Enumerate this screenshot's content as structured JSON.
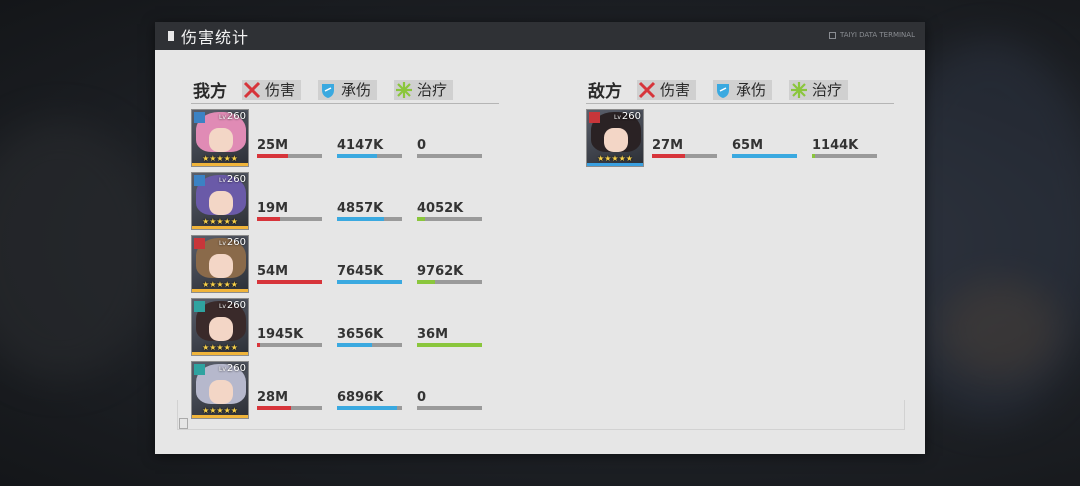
{
  "window": {
    "title": "伤害统计",
    "terminal_label": "TAIYI DATA TERMINAL"
  },
  "colors": {
    "damage": "#d7343a",
    "taken": "#3aa9e0",
    "heal": "#8ac63c",
    "track": "#9a9a9a",
    "rarity": "#f0b43a",
    "enemy_rarity": "#3aa0e0"
  },
  "headers": {
    "damage": "伤害",
    "taken": "承伤",
    "heal": "治疗",
    "damage_icon": "crossed-swords-icon",
    "taken_icon": "shield-icon",
    "heal_icon": "heal-burst-icon"
  },
  "ally": {
    "name": "我方",
    "members": [
      {
        "level": "260",
        "level_prefix": "Lv",
        "class_icon": "gear-class-icon",
        "class_color": "#3b82c4",
        "hair": "#e08bb5",
        "stars": "★★★★★",
        "damage": "25M",
        "damage_ratio": 0.48,
        "taken": "4147K",
        "taken_ratio": 0.62,
        "heal": "0",
        "heal_ratio": 0
      },
      {
        "level": "260",
        "level_prefix": "Lv",
        "class_icon": "gear-class-icon",
        "class_color": "#3b82c4",
        "hair": "#6a5aa8",
        "stars": "★★★★★",
        "damage": "19M",
        "damage_ratio": 0.36,
        "taken": "4857K",
        "taken_ratio": 0.72,
        "heal": "4052K",
        "heal_ratio": 0.12
      },
      {
        "level": "260",
        "level_prefix": "Lv",
        "class_icon": "tower-class-icon",
        "class_color": "#c8363a",
        "hair": "#8a6a4a",
        "stars": "★★★★★",
        "damage": "54M",
        "damage_ratio": 1.0,
        "taken": "7645K",
        "taken_ratio": 1.0,
        "heal": "9762K",
        "heal_ratio": 0.27
      },
      {
        "level": "260",
        "level_prefix": "Lv",
        "class_icon": "flower-class-icon",
        "class_color": "#2fa3a0",
        "hair": "#3a2a2a",
        "stars": "★★★★★",
        "damage": "1945K",
        "damage_ratio": 0.05,
        "taken": "3656K",
        "taken_ratio": 0.54,
        "heal": "36M",
        "heal_ratio": 1.0
      },
      {
        "level": "260",
        "level_prefix": "Lv",
        "class_icon": "flower-class-icon",
        "class_color": "#2fa3a0",
        "hair": "#b6b8cc",
        "stars": "★★★★★",
        "damage": "28M",
        "damage_ratio": 0.52,
        "taken": "6896K",
        "taken_ratio": 0.92,
        "heal": "0",
        "heal_ratio": 0
      }
    ]
  },
  "enemy": {
    "name": "敌方",
    "members": [
      {
        "level": "260",
        "level_prefix": "Lv",
        "class_icon": "tower-class-icon",
        "class_color": "#c8363a",
        "hair": "#2a2224",
        "stars": "★★★★★",
        "damage": "27M",
        "damage_ratio": 0.5,
        "taken": "65M",
        "taken_ratio": 1.0,
        "heal": "1144K",
        "heal_ratio": 0.05
      }
    ]
  }
}
